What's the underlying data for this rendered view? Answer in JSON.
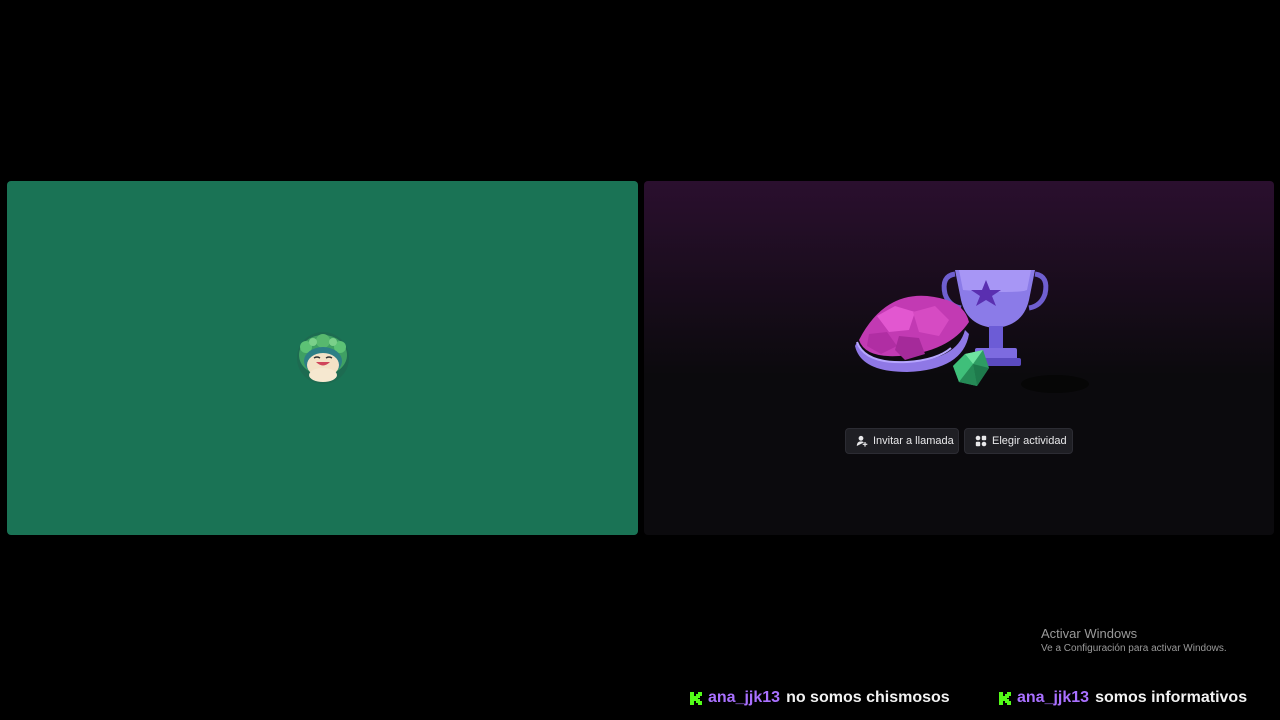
{
  "colors": {
    "background": "#000000",
    "left_tile_bg": "#1a7355",
    "right_tile_gradient_top": "#2a0f2e",
    "right_tile_gradient_bottom": "#0b0a0d",
    "button_bg": "#1f1f24",
    "chat_username": "#a970ff",
    "kick_brand": "#53fc18"
  },
  "call": {
    "left_tile": {
      "avatar_icon": "snorlax-avatar-icon"
    },
    "right_tile": {
      "illustration_icon": "trophy-shell-gem-illustration",
      "buttons": {
        "invite_label": "Invitar a llamada",
        "invite_icon": "person-add-icon",
        "activity_label": "Elegir actividad",
        "activity_icon": "activities-grid-icon"
      }
    }
  },
  "watermark": {
    "title": "Activar Windows",
    "subtitle": "Ve a Configuración para activar Windows."
  },
  "chat": [
    {
      "platform_icon": "kick-logo-icon",
      "username": "ana_jjk13",
      "message": "no somos chismosos"
    },
    {
      "platform_icon": "kick-logo-icon",
      "username": "ana_jjk13",
      "message": "somos informativos"
    }
  ]
}
